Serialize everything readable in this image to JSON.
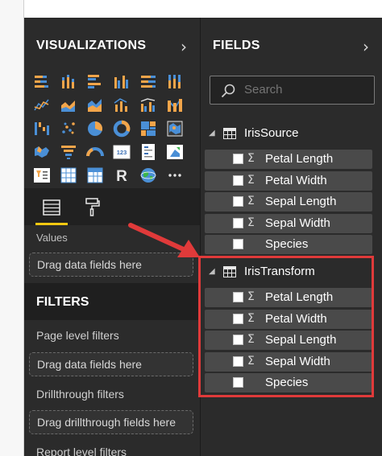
{
  "visualizations": {
    "title": "VISUALIZATIONS",
    "expand_icon": "chevron-right-icon",
    "icons": [
      "stacked-bar-chart-icon",
      "stacked-column-chart-icon",
      "clustered-bar-chart-icon",
      "clustered-column-chart-icon",
      "100-stacked-bar-chart-icon",
      "100-stacked-column-chart-icon",
      "line-chart-icon",
      "area-chart-icon",
      "stacked-area-chart-icon",
      "line-and-column-chart-icon",
      "line-and-clustered-column-chart-icon",
      "ribbon-chart-icon",
      "waterfall-chart-icon",
      "scatter-chart-icon",
      "pie-chart-icon",
      "donut-chart-icon",
      "treemap-icon",
      "map-icon",
      "filled-map-icon",
      "funnel-icon",
      "gauge-icon",
      "card-icon",
      "multi-row-card-icon",
      "kpi-icon",
      "slicer-icon",
      "table-icon",
      "matrix-icon",
      "r-script-visual-icon",
      "globe-map-icon",
      "more-visuals-icon"
    ],
    "tools": {
      "fields_tool": "fields-well-icon",
      "format_tool": "paint-roller-icon"
    },
    "values_label": "Values",
    "values_drop": "Drag data fields here"
  },
  "filters": {
    "title": "FILTERS",
    "page_level_label": "Page level filters",
    "page_level_drop": "Drag data fields here",
    "drillthrough_label": "Drillthrough filters",
    "drillthrough_drop": "Drag drillthrough fields here",
    "report_level_label": "Report level filters"
  },
  "fields": {
    "title": "FIELDS",
    "expand_icon": "chevron-right-icon",
    "search": {
      "placeholder": "Search",
      "icon": "search-icon"
    },
    "tables": [
      {
        "name": "IrisSource",
        "fields": [
          {
            "name": "Petal Length",
            "sigma": "Σ"
          },
          {
            "name": "Petal Width",
            "sigma": "Σ"
          },
          {
            "name": "Sepal Length",
            "sigma": "Σ"
          },
          {
            "name": "Sepal Width",
            "sigma": "Σ"
          },
          {
            "name": "Species",
            "sigma": ""
          }
        ]
      },
      {
        "name": "IrisTransform",
        "fields": [
          {
            "name": "Petal Length",
            "sigma": "Σ"
          },
          {
            "name": "Petal Width",
            "sigma": "Σ"
          },
          {
            "name": "Sepal Length",
            "sigma": "Σ"
          },
          {
            "name": "Sepal Width",
            "sigma": "Σ"
          },
          {
            "name": "Species",
            "sigma": ""
          }
        ]
      }
    ]
  },
  "colors": {
    "pane_bg": "#2b2b2b",
    "accent_yellow": "#f2c811",
    "highlight_red": "#e03a3a",
    "icon_orange": "#f2a54a",
    "icon_blue": "#4a8fd6"
  }
}
